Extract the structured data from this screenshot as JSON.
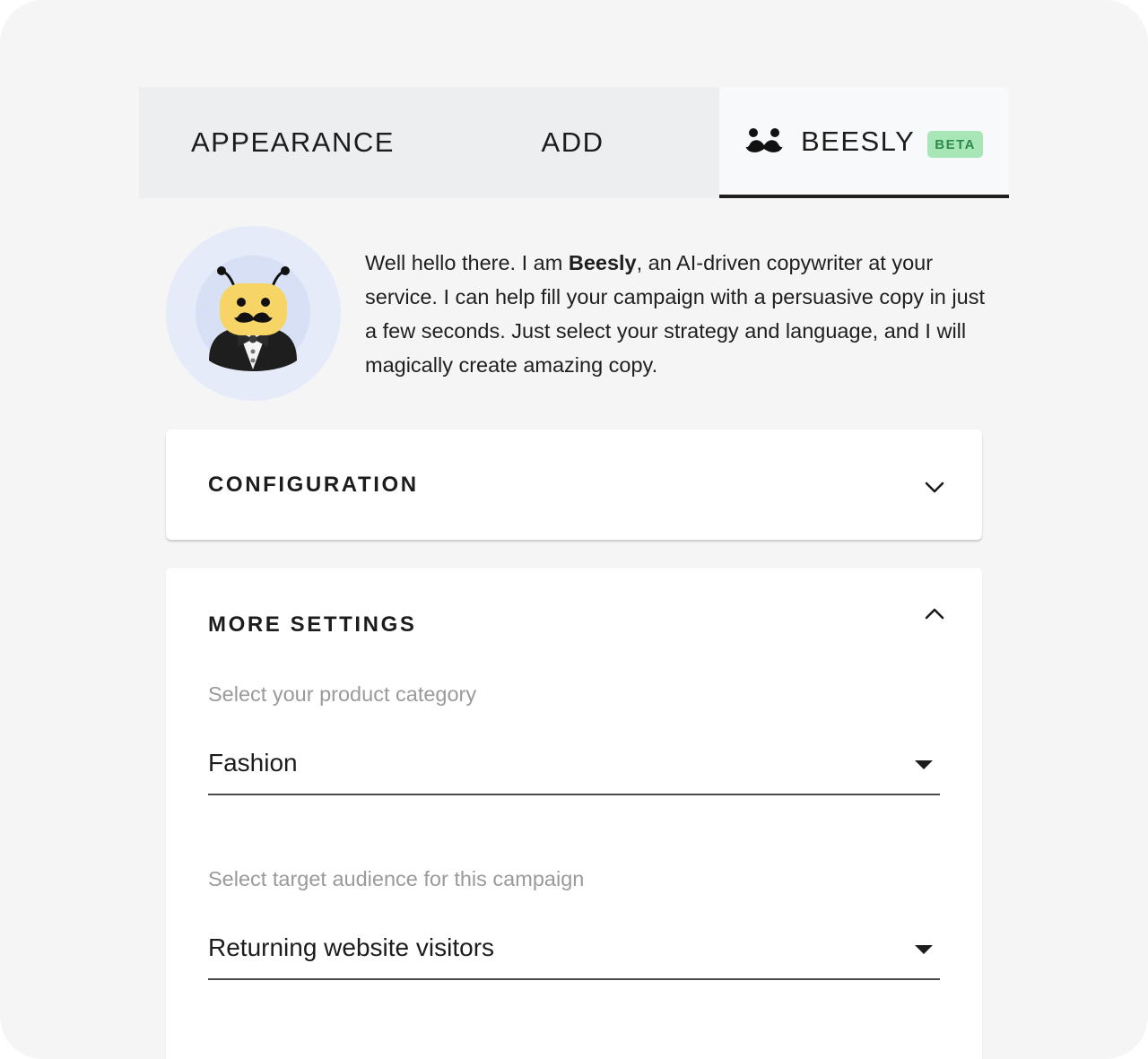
{
  "tabs": {
    "appearance": "APPEARANCE",
    "add": "ADD",
    "beesly": "BEESLY",
    "beta_badge": "BETA",
    "active": "beesly"
  },
  "intro": {
    "greeting": "Well hello there. I am ",
    "name": "Beesly",
    "body": ", an AI-driven copywriter at your service. I can help fill your campaign with a persuasive copy in just a few seconds. Just select your strategy and language, and I will magically create amazing copy."
  },
  "configuration": {
    "title": "CONFIGURATION",
    "expanded": false,
    "icon": "chevron-down-icon"
  },
  "more_settings": {
    "title": "MORE SETTINGS",
    "expanded": true,
    "icon": "chevron-up-icon",
    "product_category": {
      "label": "Select your product category",
      "value": "Fashion"
    },
    "target_audience": {
      "label": "Select target audience for this campaign",
      "value": "Returning website visitors"
    }
  },
  "colors": {
    "beta_bg": "#a9e6b7",
    "beta_text": "#2c8a4c",
    "active_tab_underline": "#1f1f1f",
    "avatar_outer": "#e6ebf9"
  }
}
